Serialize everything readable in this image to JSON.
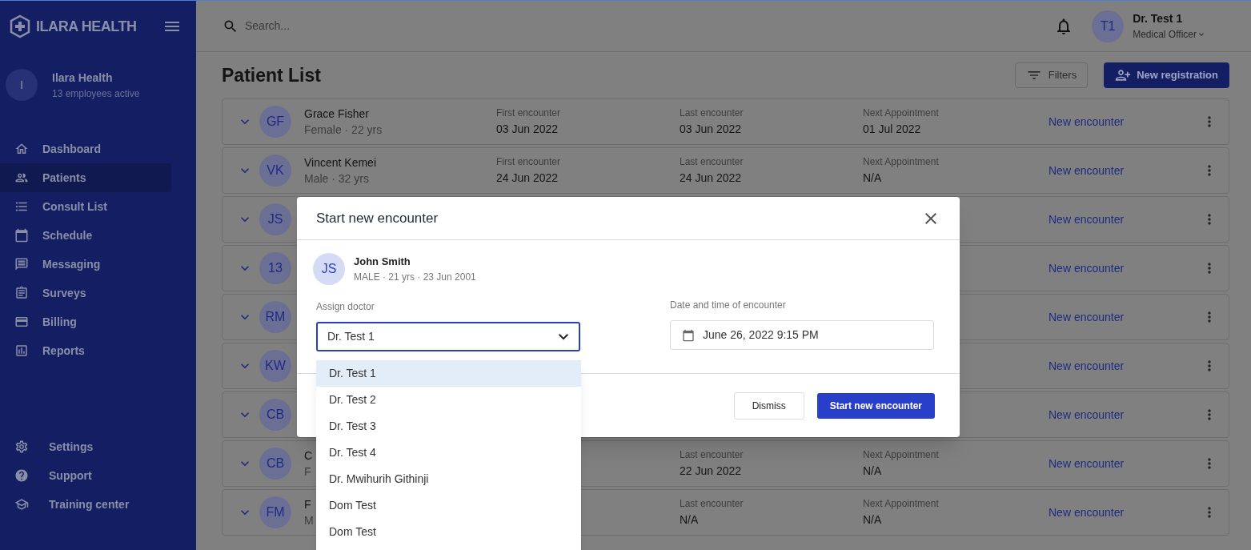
{
  "brand": {
    "name": "ILARA HEALTH"
  },
  "organization": {
    "initial": "I",
    "name": "Ilara Health",
    "subtitle": "13 employees active"
  },
  "nav": [
    {
      "label": "Dashboard",
      "selected": false
    },
    {
      "label": "Patients",
      "selected": true
    },
    {
      "label": "Consult List",
      "selected": false
    },
    {
      "label": "Schedule",
      "selected": false
    },
    {
      "label": "Messaging",
      "selected": false
    },
    {
      "label": "Surveys",
      "selected": false
    },
    {
      "label": "Billing",
      "selected": false
    },
    {
      "label": "Reports",
      "selected": false
    }
  ],
  "footer_nav": [
    {
      "label": "Settings"
    },
    {
      "label": "Support"
    },
    {
      "label": "Training center"
    }
  ],
  "search": {
    "placeholder": "Search..."
  },
  "user": {
    "initials": "T1",
    "name": "Dr. Test 1",
    "role": "Medical Officer"
  },
  "page": {
    "title": "Patient List",
    "filters": "Filters",
    "new_registration": "New registration"
  },
  "patients": [
    {
      "initials": "GF",
      "name": "Grace Fisher",
      "details": "Female · 22 yrs",
      "first": {
        "label": "First encounter",
        "value": "03 Jun 2022"
      },
      "last": {
        "label": "Last encounter",
        "value": "03 Jun 2022"
      },
      "next": {
        "label": "Next Appointment",
        "value": "01 Jul 2022"
      },
      "action": "New encounter"
    },
    {
      "initials": "VK",
      "name": "Vincent Kemei",
      "details": "Male · 32 yrs",
      "first": {
        "label": "First encounter",
        "value": "24 Jun 2022"
      },
      "last": {
        "label": "Last encounter",
        "value": "24 Jun 2022"
      },
      "next": {
        "label": "Next Appointment",
        "value": "N/A"
      },
      "action": "New encounter"
    },
    {
      "initials": "JS",
      "action": "New encounter"
    },
    {
      "initials": "13",
      "action": "New encounter"
    },
    {
      "initials": "RM",
      "action": "New encounter"
    },
    {
      "initials": "KW",
      "action": "New encounter"
    },
    {
      "initials": "CB",
      "action": "New encounter"
    },
    {
      "initials": "CB",
      "name": "C",
      "details": "F",
      "last": {
        "label": "Last encounter",
        "value": "22 Jun 2022"
      },
      "next": {
        "label": "Next Appointment",
        "value": "N/A"
      },
      "action": "New encounter"
    },
    {
      "initials": "FM",
      "name": "F",
      "details": "M",
      "last": {
        "label": "Last encounter",
        "value": "N/A"
      },
      "next": {
        "label": "Next Appointment",
        "value": "N/A"
      },
      "action": "New encounter"
    }
  ],
  "modal": {
    "title": "Start new encounter",
    "patient": {
      "initials": "JS",
      "name": "John Smith",
      "details": "MALE · 21 yrs · 23 Jun 2001"
    },
    "doctor_label": "Assign doctor",
    "doctor_value": "Dr. Test 1",
    "date_label": "Date and time of encounter",
    "date_value": "June 26, 2022 9:15 PM",
    "options": [
      {
        "label": "Dr. Test 1",
        "selected": true
      },
      {
        "label": "Dr. Test 2",
        "selected": false
      },
      {
        "label": "Dr. Test 3",
        "selected": false
      },
      {
        "label": "Dr. Test 4",
        "selected": false
      },
      {
        "label": "Dr. Mwihurih Githinji",
        "selected": false
      },
      {
        "label": "Dom Test",
        "selected": false
      },
      {
        "label": "Dom Test",
        "selected": false
      }
    ],
    "dismiss": "Dismiss",
    "confirm": "Start new encounter"
  }
}
